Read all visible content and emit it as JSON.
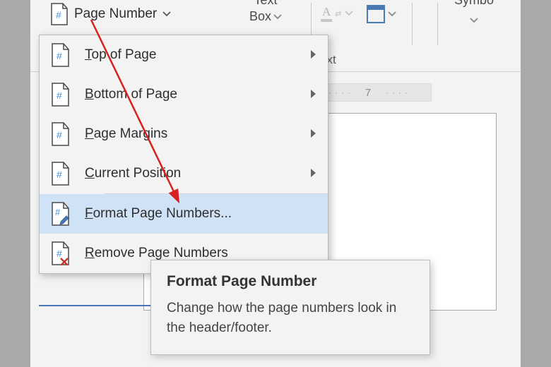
{
  "ribbon": {
    "page_number": "Page Number",
    "text_box_line1": "Text",
    "text_box_line2": "Box",
    "font_color": "A",
    "symbols": "Symbo",
    "group_text": "ext"
  },
  "ruler": {
    "mark": "7"
  },
  "menu": {
    "items": [
      {
        "key": "T",
        "rest": "op of Page",
        "has_arrow": true,
        "name": "top-of-page"
      },
      {
        "key": "B",
        "rest": "ottom of Page",
        "has_arrow": true,
        "name": "bottom-of-page"
      },
      {
        "key": "P",
        "rest": "age Margins",
        "has_arrow": true,
        "name": "page-margins"
      },
      {
        "key": "C",
        "rest": "urrent Position",
        "has_arrow": true,
        "name": "current-position"
      }
    ],
    "format": {
      "key": "F",
      "rest": "ormat Page Numbers..."
    },
    "remove": {
      "key": "R",
      "rest": "emove Page Numbers"
    }
  },
  "tooltip": {
    "title": "Format Page Number",
    "body": "Change how the page numbers look in the header/footer."
  }
}
